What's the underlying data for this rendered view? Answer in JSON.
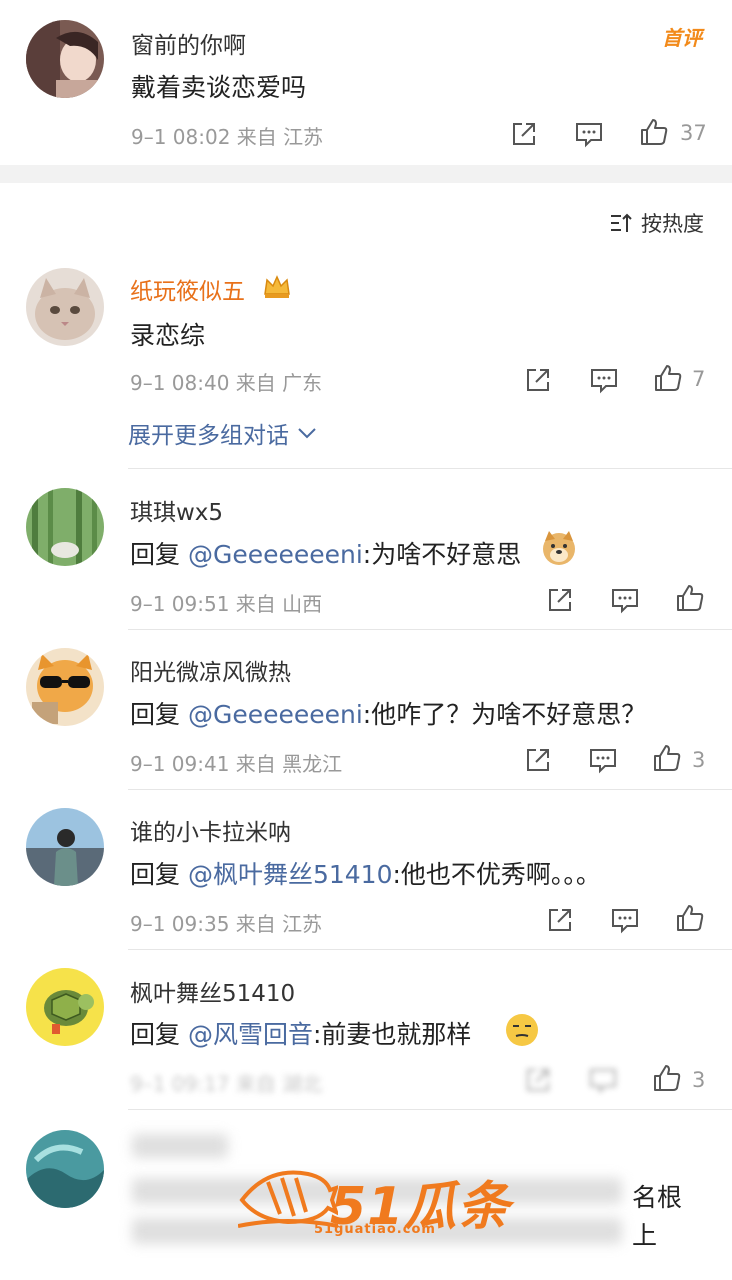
{
  "top_comment": {
    "name": "窗前的你啊",
    "badge": "首评",
    "text": "戴着卖谈恋爱吗",
    "meta": "9–1 08:02  来自 江苏",
    "likes": "37"
  },
  "sort": {
    "label": "按热度"
  },
  "main_comment": {
    "name": "纸玩筱似五",
    "text": "录恋综",
    "meta": "9–1 08:40  来自 广东",
    "likes": "7",
    "expand_label": "展开更多组对话"
  },
  "replies": [
    {
      "name": "琪琪wx5",
      "prefix": "回复 ",
      "mention": "@Geeeeeeeni",
      "text": ":为啥不好意思",
      "meta": "9–1 09:51  来自 山西",
      "likes": ""
    },
    {
      "name": "阳光微凉风微热",
      "prefix": "回复 ",
      "mention": "@Geeeeeeeni",
      "text": ":他咋了？为啥不好意思？",
      "meta": "9–1 09:41  来自 黑龙江",
      "likes": "3"
    },
    {
      "name": "谁的小卡拉米呐",
      "prefix": "回复 ",
      "mention": "@枫叶舞丝51410",
      "text": ":他也不优秀啊。。。",
      "meta": "9–1 09:35  来自 江苏",
      "likes": ""
    },
    {
      "name": "枫叶舞丝51410",
      "prefix": "回复 ",
      "mention": "@风雪回音",
      "text": ":前妻也就那样",
      "meta": "9–1 09:17  来自 湖北",
      "likes": "3"
    }
  ],
  "partial": {
    "tail_1": "名根",
    "tail_2": "上"
  },
  "watermark": {
    "brand": "51瓜条",
    "url": "51guatiao.com"
  },
  "colors": {
    "accent_link": "#4a6aa0",
    "vip_name": "#e8711a",
    "meta": "#999999",
    "watermark": "#f07a1e"
  }
}
